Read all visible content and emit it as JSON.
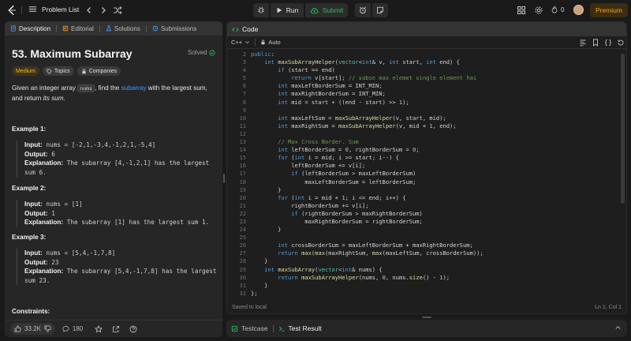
{
  "topbar": {
    "problem_list_label": "Problem List",
    "run_label": "Run",
    "submit_label": "Submit",
    "streak_count": "0",
    "premium_label": "Premium"
  },
  "left": {
    "tabs": [
      {
        "label": "Description",
        "icon": "description-icon"
      },
      {
        "label": "Editorial",
        "icon": "editorial-icon"
      },
      {
        "label": "Solutions",
        "icon": "flask-icon"
      },
      {
        "label": "Submissions",
        "icon": "history-icon"
      }
    ],
    "title": "53. Maximum Subarray",
    "solved_label": "Solved",
    "difficulty": "Medium",
    "topics_label": "Topics",
    "companies_label": "Companies",
    "desc_prefix": "Given an integer array ",
    "desc_code": "nums",
    "desc_mid": ", find the ",
    "desc_link": "subarray",
    "desc_suffix": " with the largest sum, and return ",
    "desc_em": "its sum",
    "desc_end": ".",
    "examples": [
      {
        "title": "Example 1:",
        "input_label": "Input:",
        "input": "nums = [-2,1,-3,4,-1,2,1,-5,4]",
        "output_label": "Output:",
        "output": "6",
        "explanation_label": "Explanation:",
        "explanation": "The subarray [4,-1,2,1] has the largest sum 6."
      },
      {
        "title": "Example 2:",
        "input_label": "Input:",
        "input": "nums = [1]",
        "output_label": "Output:",
        "output": "1",
        "explanation_label": "Explanation:",
        "explanation": "The subarray [1] has the largest sum 1."
      },
      {
        "title": "Example 3:",
        "input_label": "Input:",
        "input": "nums = [5,4,-1,7,8]",
        "output_label": "Output:",
        "output": "23",
        "explanation_label": "Explanation:",
        "explanation": "The subarray [5,4,-1,7,8] has the largest sum 23."
      }
    ],
    "constraints_label": "Constraints:",
    "likes": "33.2K",
    "comments": "180"
  },
  "code": {
    "header_label": "Code",
    "language": "C++",
    "auto_label": "Auto",
    "status_left": "Saved to local",
    "status_right": "Ln 1, Col 1",
    "first_line_number": 2,
    "lines": [
      [
        [
          "kw",
          "public"
        ],
        [
          "",
          ":"
        ]
      ],
      [
        [
          "",
          "    "
        ],
        [
          "kw",
          "int"
        ],
        [
          "",
          " "
        ],
        [
          "fn",
          "maxSubArrayHelper"
        ],
        [
          "",
          "("
        ],
        [
          "ty",
          "vector"
        ],
        [
          "",
          "<"
        ],
        [
          "kw",
          "int"
        ],
        [
          "",
          "& v, "
        ],
        [
          "kw",
          "int"
        ],
        [
          "",
          " start, "
        ],
        [
          "kw",
          "int"
        ],
        [
          "",
          " end) {"
        ]
      ],
      [
        [
          "",
          "        "
        ],
        [
          "kw",
          "if"
        ],
        [
          "",
          " (start == end)"
        ]
      ],
      [
        [
          "",
          "            "
        ],
        [
          "kw",
          "return"
        ],
        [
          "",
          " v[start]; "
        ],
        [
          "cm",
          "// sabse max elemet single element hai"
        ]
      ],
      [
        [
          "",
          "        "
        ],
        [
          "kw",
          "int"
        ],
        [
          "",
          " maxLeftBorderSum = INT_MIN;"
        ]
      ],
      [
        [
          "",
          "        "
        ],
        [
          "kw",
          "int"
        ],
        [
          "",
          " maxRightBorderSum = INT_MIN;"
        ]
      ],
      [
        [
          "",
          "        "
        ],
        [
          "kw",
          "int"
        ],
        [
          "",
          " mid = start + ((end - start) >> "
        ],
        [
          "nm",
          "1"
        ],
        [
          "",
          "); "
        ]
      ],
      [
        [
          "",
          ""
        ]
      ],
      [
        [
          "",
          "        "
        ],
        [
          "kw",
          "int"
        ],
        [
          "",
          " maxLeftSum = "
        ],
        [
          "fn",
          "maxSubArrayHelper"
        ],
        [
          "",
          "(v, start, mid);"
        ]
      ],
      [
        [
          "",
          "        "
        ],
        [
          "kw",
          "int"
        ],
        [
          "",
          " maxRightSum = "
        ],
        [
          "fn",
          "maxSubArrayHelper"
        ],
        [
          "",
          "(v, mid + "
        ],
        [
          "nm",
          "1"
        ],
        [
          "",
          ", end);"
        ]
      ],
      [
        [
          "",
          ""
        ]
      ],
      [
        [
          "",
          "        "
        ],
        [
          "cm",
          "// Max Cross Border. Sum"
        ]
      ],
      [
        [
          "",
          "        "
        ],
        [
          "kw",
          "int"
        ],
        [
          "",
          " leftBorderSum = "
        ],
        [
          "nm",
          "0"
        ],
        [
          "",
          ", rightBorderSum = "
        ],
        [
          "nm",
          "0"
        ],
        [
          "",
          ";"
        ]
      ],
      [
        [
          "",
          "        "
        ],
        [
          "kw",
          "for"
        ],
        [
          "",
          " ("
        ],
        [
          "kw",
          "int"
        ],
        [
          "",
          " i = mid; i >= start; i--) {"
        ]
      ],
      [
        [
          "",
          "            leftBorderSum += v[i];"
        ]
      ],
      [
        [
          "",
          "            "
        ],
        [
          "kw",
          "if"
        ],
        [
          "",
          " (leftBorderSum > maxLeftBorderSum)"
        ]
      ],
      [
        [
          "",
          "                maxLeftBorderSum = leftBorderSum;"
        ]
      ],
      [
        [
          "",
          "        }"
        ]
      ],
      [
        [
          "",
          "        "
        ],
        [
          "kw",
          "for"
        ],
        [
          "",
          " ("
        ],
        [
          "kw",
          "int"
        ],
        [
          "",
          " i = mid + "
        ],
        [
          "nm",
          "1"
        ],
        [
          "",
          "; i <= end; i++) {"
        ]
      ],
      [
        [
          "",
          "            rightBorderSum += v[i];"
        ]
      ],
      [
        [
          "",
          "            "
        ],
        [
          "kw",
          "if"
        ],
        [
          "",
          " (rightBorderSum > maxRightBorderSum)"
        ]
      ],
      [
        [
          "",
          "                maxRightBorderSum = rightBorderSum;"
        ]
      ],
      [
        [
          "",
          "        }"
        ]
      ],
      [
        [
          "",
          ""
        ]
      ],
      [
        [
          "",
          "        "
        ],
        [
          "kw",
          "int"
        ],
        [
          "",
          " crossBorderSum = maxLeftBorderSum + maxRightBorderSum;"
        ]
      ],
      [
        [
          "",
          "        "
        ],
        [
          "kw",
          "return"
        ],
        [
          "",
          " "
        ],
        [
          "fn",
          "max"
        ],
        [
          "",
          "("
        ],
        [
          "fn",
          "max"
        ],
        [
          "",
          "(maxRightSum, "
        ],
        [
          "fn",
          "max"
        ],
        [
          "",
          "(maxLeftSum, crossBorderSum));"
        ]
      ],
      [
        [
          "",
          "    }"
        ]
      ],
      [
        [
          "",
          "    "
        ],
        [
          "kw",
          "int"
        ],
        [
          "",
          " "
        ],
        [
          "fn",
          "maxSubArray"
        ],
        [
          "",
          "("
        ],
        [
          "ty",
          "vector"
        ],
        [
          "",
          "<"
        ],
        [
          "kw",
          "int"
        ],
        [
          "",
          "& nums) {"
        ]
      ],
      [
        [
          "",
          "        "
        ],
        [
          "kw",
          "return"
        ],
        [
          "",
          " "
        ],
        [
          "fn",
          "maxSubArrayHelper"
        ],
        [
          "",
          "(nums, "
        ],
        [
          "nm",
          "0"
        ],
        [
          "",
          ", nums."
        ],
        [
          "fn",
          "size"
        ],
        [
          "",
          "() - "
        ],
        [
          "nm",
          "1"
        ],
        [
          "",
          ");"
        ]
      ],
      [
        [
          "",
          "    }"
        ]
      ],
      [
        [
          "",
          "};"
        ]
      ]
    ]
  },
  "bottom": {
    "testcase_label": "Testcase",
    "result_label": "Test Result"
  },
  "colors": {
    "accent_green": "#2cbb5d",
    "premium_orange": "#ffa116",
    "medium_yellow": "#ffb800",
    "link_blue": "#3b9eff"
  }
}
